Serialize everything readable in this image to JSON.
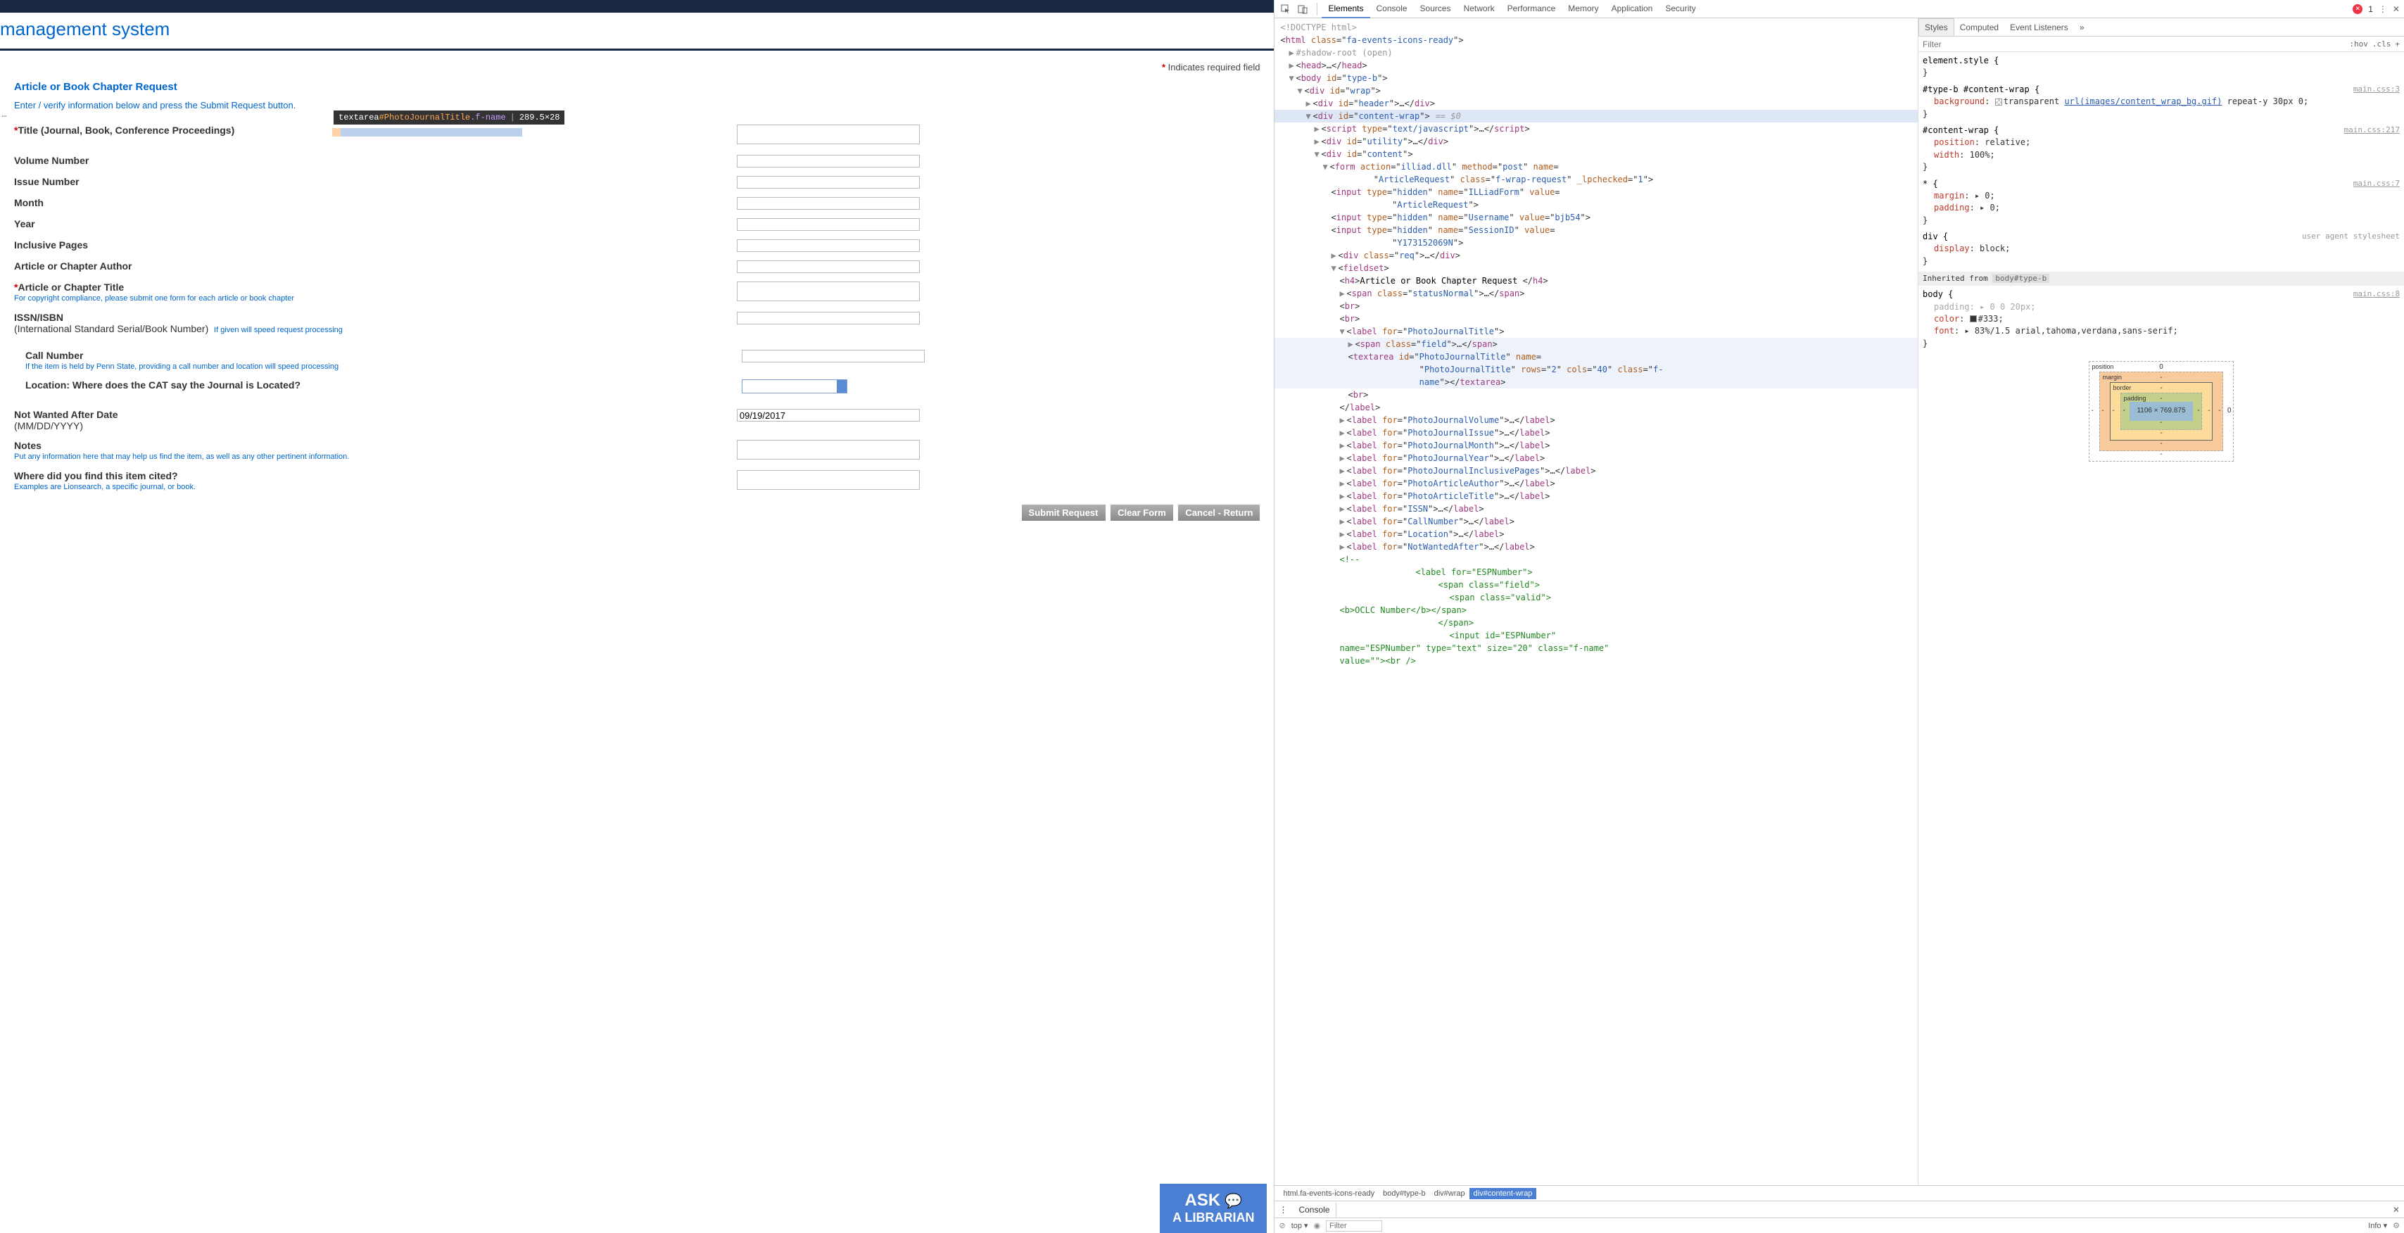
{
  "page": {
    "title": "management system",
    "required_text": "Indicates required field",
    "section_title": "Article or Book Chapter Request",
    "section_sub": "Enter / verify information below and press the Submit Request button.",
    "labels": {
      "title": "Title (Journal, Book, Conference Proceedings)",
      "volume": "Volume Number",
      "issue": "Issue Number",
      "month": "Month",
      "year": "Year",
      "pages": "Inclusive Pages",
      "author": "Article or Chapter Author",
      "atitle": "Article or Chapter Title",
      "atitle_hint": "For copyright compliance, please submit one form for each article or book chapter",
      "issn": "ISSN/ISBN",
      "issn_sub": "(International Standard Serial/Book Number)",
      "issn_hint": "If given will speed request processing",
      "callnum": "Call Number",
      "callnum_hint": "If the item is held by Penn State, providing a call number and location will speed processing",
      "location": "Location: Where does the CAT say the Journal is Located?",
      "notwanted": "Not Wanted After Date",
      "notwanted_sub": "(MM/DD/YYYY)",
      "notes": "Notes",
      "notes_hint": "Put any information here that may help us find the item, as well as any other pertinent information.",
      "cited": "Where did you find this item cited?",
      "cited_hint": "Examples are Lionsearch, a specific journal, or book."
    },
    "values": {
      "notwanted": "09/19/2017"
    },
    "buttons": {
      "submit": "Submit Request",
      "clear": "Clear Form",
      "cancel": "Cancel - Return"
    },
    "ask": {
      "big": "ASK",
      "small": "A LIBRARIAN"
    }
  },
  "tooltip": {
    "tag": "textarea",
    "id": "#PhotoJournalTitle",
    "cls": ".f-name",
    "dims": "289.5×28"
  },
  "devtools": {
    "tabs": [
      "Elements",
      "Console",
      "Sources",
      "Network",
      "Performance",
      "Memory",
      "Application",
      "Security"
    ],
    "active_tab": "Elements",
    "error_count": "1",
    "styles_tabs": [
      "Styles",
      "Computed",
      "Event Listeners"
    ],
    "styles_active": "Styles",
    "filter_placeholder": "Filter",
    "hov": ":hov",
    "cls": ".cls",
    "breadcrumb": [
      "html.fa-events-icons-ready",
      "body#type-b",
      "div#wrap",
      "div#content-wrap"
    ],
    "console_label": "Console",
    "bottom_top": "top",
    "bottom_filter": "Filter",
    "bottom_info": "Info",
    "box": {
      "content": "1106 × 769.875",
      "pos": "0",
      "margin": "-",
      "border": "-",
      "padding": "-"
    }
  },
  "dom": {
    "doctype": "<!DOCTYPE html>",
    "html_open": "<html class=\"fa-events-icons-ready\">",
    "shadow": "#shadow-root (open)",
    "head": "<head>…</head>",
    "body": "<body id=\"type-b\">",
    "wrap": "<div id=\"wrap\">",
    "header": "<div id=\"header\">…</div>",
    "cwrap": "<div id=\"content-wrap\">",
    "eq0": "== $0",
    "script": "<script type=\"text/javascript\">…</script>",
    "utility": "<div id=\"utility\">…</div>",
    "content": "<div id=\"content\">",
    "form": "<form action=\"illiad.dll\" method=\"post\" name=\"ArticleRequest\" class=\"f-wrap-request\" _lpchecked=\"1\">",
    "input1": "<input type=\"hidden\" name=\"ILLiadForm\" value=\"ArticleRequest\">",
    "input2": "<input type=\"hidden\" name=\"Username\" value=\"bjb54\">",
    "input3": "<input type=\"hidden\" name=\"SessionID\" value=\"Y173152069N\">",
    "req": "<div class=\"req\">…</div>",
    "fieldset": "<fieldset>",
    "h4": "<h4>Article or Book Chapter Request </h4>",
    "status": "<span class=\"statusNormal\">…</span>",
    "br": "<br>",
    "label_pjt": "<label for=\"PhotoJournalTitle\">",
    "span_field": "<span class=\"field\">…</span>",
    "textarea": "<textarea id=\"PhotoJournalTitle\" name=\"PhotoJournalTitle\" rows=\"2\" cols=\"40\" class=\"f-name\"></textarea>",
    "label_close": "</label>",
    "lbl_vol": "<label for=\"PhotoJournalVolume\">…</label>",
    "lbl_issue": "<label for=\"PhotoJournalIssue\">…</label>",
    "lbl_month": "<label for=\"PhotoJournalMonth\">…</label>",
    "lbl_year": "<label for=\"PhotoJournalYear\">…</label>",
    "lbl_pages": "<label for=\"PhotoJournalInclusivePages\">…</label>",
    "lbl_author": "<label for=\"PhotoArticleAuthor\">…</label>",
    "lbl_atitle": "<label for=\"PhotoArticleTitle\">…</label>",
    "lbl_issn": "<label for=\"ISSN\">…</label>",
    "lbl_call": "<label for=\"CallNumber\">…</label>",
    "lbl_loc": "<label for=\"Location\">…</label>",
    "lbl_nwa": "<label for=\"NotWantedAfter\">…</label>",
    "comment": "<!--",
    "esp_label": "<label for=\"ESPNumber\">",
    "esp_span_field": "<span class=\"field\">",
    "esp_span_valid": "<span class=\"valid\">",
    "oclc": "<b>OCLC Number</b></span>",
    "span_close": "</span>",
    "esp_input": "<input id=\"ESPNumber\" name=\"ESPNumber\" type=\"text\" size=\"20\" class=\"f-name\" value=\"\"><br />"
  },
  "styles": {
    "elstyle": "element.style {",
    "rule1_sel": "#type-b #content-wrap {",
    "rule1_link": "main.css:3",
    "rule1_bg": "background: ▢ transparent url(images/content_wrap_bg.gif) repeat-y 30px 0;",
    "rule2_sel": "#content-wrap {",
    "rule2_link": "main.css:217",
    "rule2_p1": "position: relative;",
    "rule2_p2": "width: 100%;",
    "rule3_sel": "* {",
    "rule3_link": "main.css:7",
    "rule3_p1": "margin: ▸ 0;",
    "rule3_p2": "padding: ▸ 0;",
    "rule4_sel": "div {",
    "rule4_link": "user agent stylesheet",
    "rule4_p1": "display: block;",
    "inherit": "Inherited from",
    "inherit_link": "body#type-b",
    "rule5_sel": "body {",
    "rule5_link": "main.css:8",
    "rule5_p1": "padding: ▸ 0 0 20px;",
    "rule5_p2": "color: ■#333;",
    "rule5_p3": "font: ▸ 83%/1.5 arial,tahoma,verdana,sans-serif;"
  }
}
